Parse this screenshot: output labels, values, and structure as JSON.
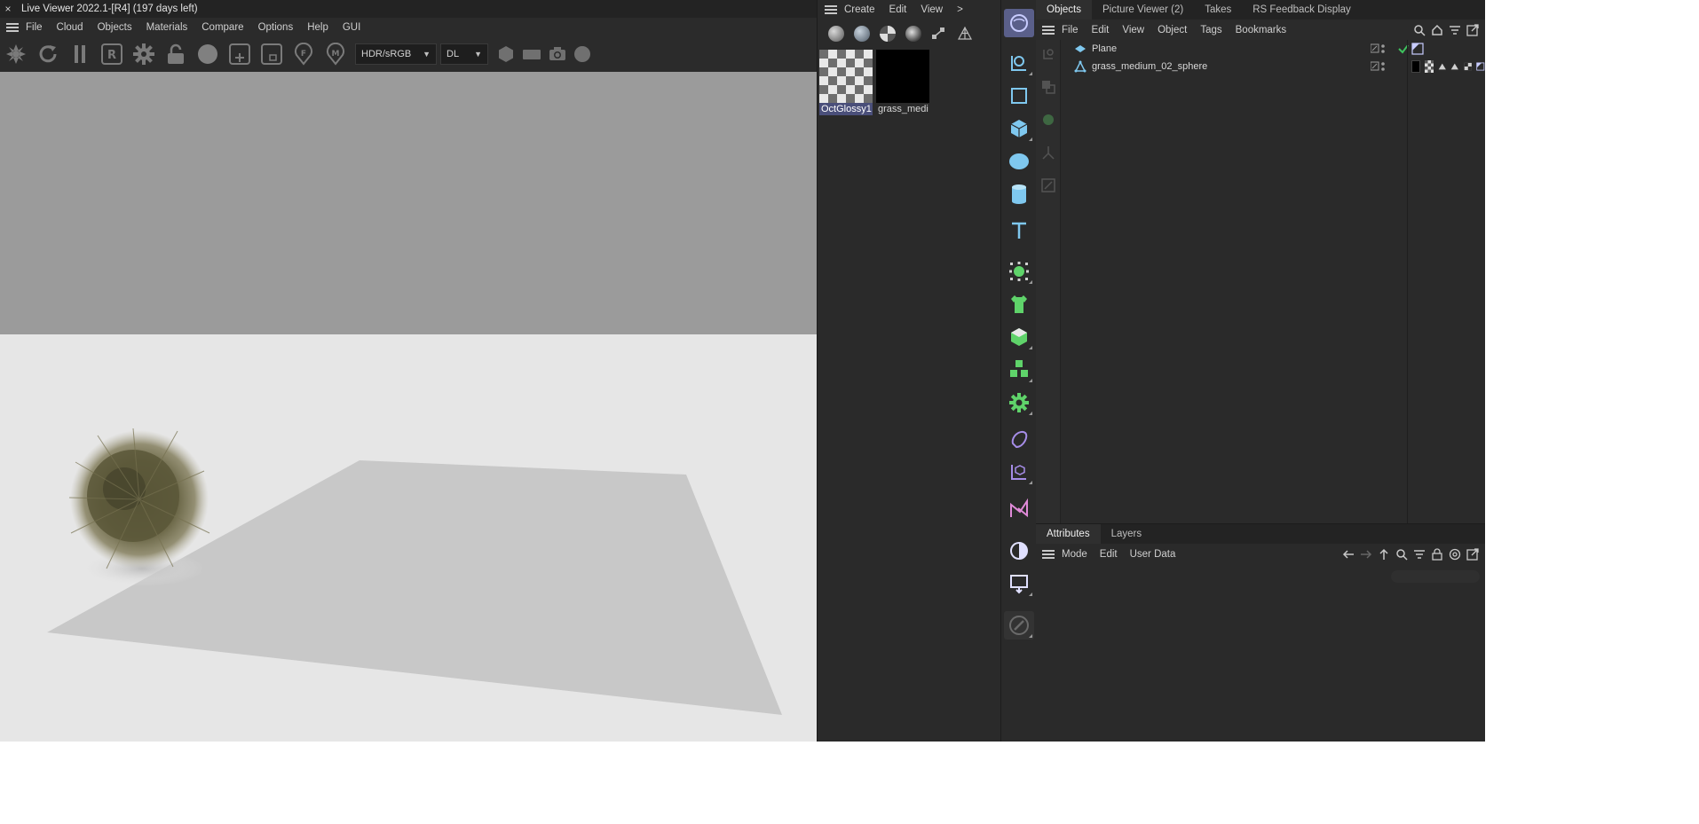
{
  "live_viewer": {
    "title": "Live Viewer 2022.1-[R4] (197 days left)",
    "close_glyph": "×",
    "menu": [
      "File",
      "Cloud",
      "Objects",
      "Materials",
      "Compare",
      "Options",
      "Help",
      "GUI"
    ],
    "toolbar_icons": [
      "send-scene-icon",
      "restart-icon",
      "pause-icon",
      "region-render-icon",
      "settings-gear-icon",
      "lock-icon",
      "material-preview-icon",
      "add-region-icon",
      "film-region-icon",
      "focus-picker-icon",
      "material-picker-icon"
    ],
    "r_label": "R",
    "f_label": "F",
    "m_label": "M",
    "color_space": "HDR/sRGB",
    "kernel": "DL"
  },
  "material_manager": {
    "menu": [
      "Create",
      "Edit",
      "View",
      ">"
    ],
    "materials": [
      {
        "name": "OctGlossy1",
        "selected": true
      },
      {
        "name": "grass_medi",
        "selected": false
      }
    ]
  },
  "objects_manager": {
    "tabs": [
      "Objects",
      "Picture Viewer (2)",
      "Takes",
      "RS Feedback Display"
    ],
    "active_tab": "Objects",
    "menu": [
      "File",
      "Edit",
      "View",
      "Object",
      "Tags",
      "Bookmarks"
    ],
    "objects": [
      {
        "name": "Plane",
        "icon": "plane-icon",
        "tags": [
          "octane-object-tag-icon"
        ]
      },
      {
        "name": "grass_medium_02_sphere",
        "icon": "polygon-object-icon",
        "tags": [
          "material-black-tag-icon",
          "material-checker-tag-icon",
          "phong-tag-icon",
          "phong-tag-icon",
          "uvw-tag-icon",
          "octane-object-tag-icon"
        ]
      }
    ]
  },
  "attributes_manager": {
    "tabs": [
      "Attributes",
      "Layers"
    ],
    "active_tab": "Attributes",
    "menu": [
      "Mode",
      "Edit",
      "User Data"
    ]
  },
  "colors": {
    "panel_bg": "#2a2a2a",
    "render_sky": "#9b9b9b",
    "render_floor": "#e6e6e6",
    "plane_color": "#c8c8c8",
    "accent_selected": "#4a4f7a",
    "primitive_blue": "#7fc8ef",
    "generator_green": "#5fd36a",
    "deformer_purple": "#a68de8"
  }
}
